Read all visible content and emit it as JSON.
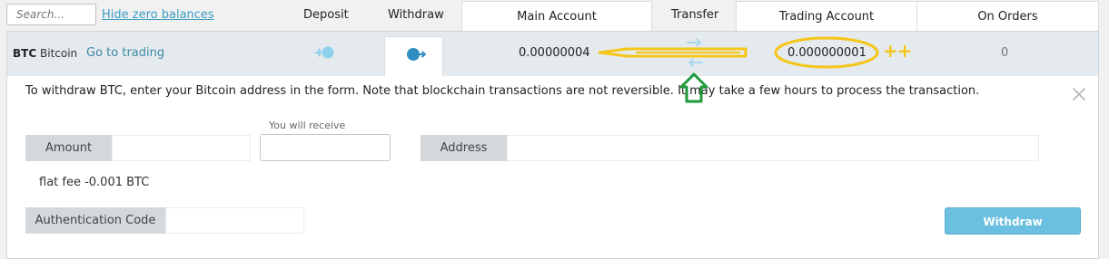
{
  "header": {
    "search_placeholder": "Search...",
    "hide_zero_label": "Hide zero balances",
    "deposit_label": "Deposit",
    "withdraw_label": "Withdraw",
    "main_account_label": "Main Account",
    "transfer_label": "Transfer",
    "trading_account_label": "Trading Account",
    "on_orders_label": "On Orders"
  },
  "currency": {
    "code": "BTC",
    "name": "Bitcoin",
    "goto_trading": "Go to trading",
    "main_balance": "0.00000004",
    "trading_balance": "0.000000001",
    "on_orders": "0"
  },
  "withdraw_form": {
    "info": "To withdraw BTC, enter your Bitcoin address in the form. Note that blockchain transactions are not reversible. It may take a few hours to process the transaction.",
    "amount_label": "Amount",
    "you_will_receive_label": "You will receive",
    "address_label": "Address",
    "fee_text": "flat fee -0.001 BTC",
    "auth_label": "Authentication Code",
    "submit_label": "Withdraw"
  },
  "annotation": {
    "plus_marks": "++"
  },
  "colors": {
    "accent": "#6bbfe0",
    "link": "#3a9cc4",
    "annotation_yellow": "#f5c518",
    "annotation_green": "#1f9a3a"
  }
}
